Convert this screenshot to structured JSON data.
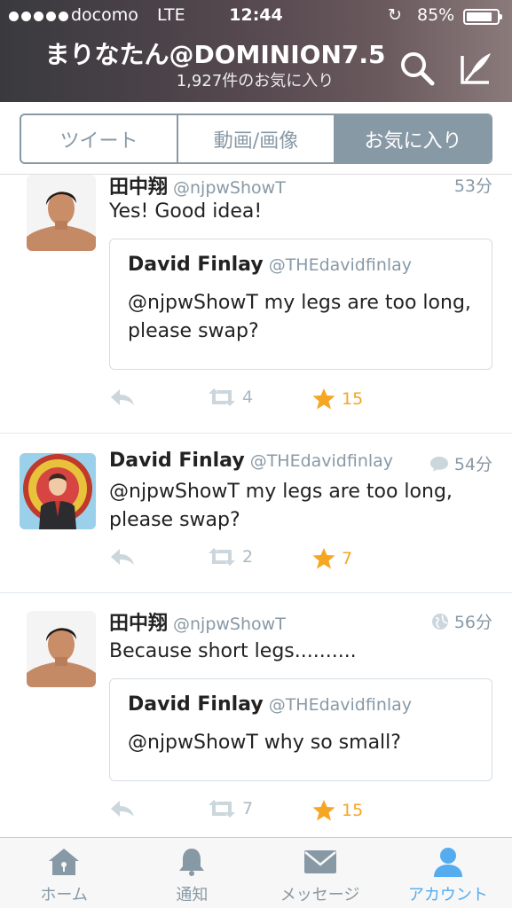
{
  "status": {
    "carrier": "docomo",
    "network": "LTE",
    "time": "12:44",
    "battery": "85%",
    "battery_level": 0.85
  },
  "header": {
    "title": "まりなたん@DOMINION7.5",
    "subtitle": "1,927件のお気に入り",
    "search_icon": "search-icon",
    "compose_icon": "compose-icon"
  },
  "segments": [
    {
      "label": "ツイート",
      "active": false
    },
    {
      "label": "動画/画像",
      "active": false
    },
    {
      "label": "お気に入り",
      "active": true
    }
  ],
  "tweets": [
    {
      "name": "田中翔",
      "handle": "@njpwShowT",
      "time": "53分",
      "text": "Yes! Good idea!",
      "quote": {
        "name": "David Finlay",
        "handle": "@THEdavidfinlay",
        "text": "@njpwShowT my legs are too long, please swap?"
      },
      "retweets": "4",
      "favorites": "15"
    },
    {
      "name": "David Finlay",
      "handle": "@THEdavidfinlay",
      "time": "54分",
      "text": "@njpwShowT my legs are too long, please swap?",
      "retweets": "2",
      "favorites": "7"
    },
    {
      "name": "田中翔",
      "handle": "@njpwShowT",
      "time": "56分",
      "text": "Because short legs..........",
      "quote": {
        "name": "David Finlay",
        "handle": "@THEdavidfinlay",
        "text": "@njpwShowT why so small?"
      },
      "retweets": "7",
      "favorites": "15"
    }
  ],
  "tabbar": [
    {
      "label": "ホーム",
      "icon": "home-icon",
      "active": false
    },
    {
      "label": "通知",
      "icon": "bell-icon",
      "active": false
    },
    {
      "label": "メッセージ",
      "icon": "envelope-icon",
      "active": false
    },
    {
      "label": "アカウント",
      "icon": "person-icon",
      "active": true
    }
  ],
  "colors": {
    "accent": "#55acee",
    "favorite": "#f5a623",
    "muted": "#8899a6"
  }
}
